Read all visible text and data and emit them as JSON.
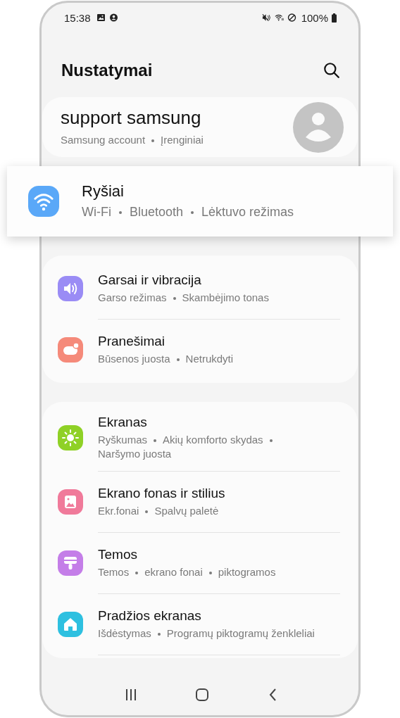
{
  "status_bar": {
    "time": "15:38",
    "battery": "100%"
  },
  "header": {
    "title": "Nustatymai"
  },
  "account": {
    "name": "support samsung",
    "parts": [
      "Samsung account",
      "Įrenginiai"
    ]
  },
  "groups": [
    {
      "continues": false,
      "items": [
        {
          "kind": "wifi",
          "color": "#5aa8f8",
          "highlighted": true,
          "title": "Ryšiai",
          "parts": [
            "Wi-Fi",
            "Bluetooth",
            "Lėktuvo režimas"
          ]
        }
      ]
    },
    {
      "continues": false,
      "items": [
        {
          "kind": "sound",
          "color": "#9a8cf5",
          "highlighted": false,
          "title": "Garsai ir vibracija",
          "parts": [
            "Garso režimas",
            "Skambėjimo tonas"
          ]
        },
        {
          "kind": "notification",
          "color": "#f58a7a",
          "highlighted": false,
          "title": "Pranešimai",
          "parts": [
            "Būsenos juosta",
            "Netrukdyti"
          ]
        }
      ]
    },
    {
      "continues": true,
      "items": [
        {
          "kind": "display",
          "color": "#8fd126",
          "highlighted": false,
          "title": "Ekranas",
          "parts": [
            "Ryškumas",
            "Akių komforto skydas",
            "Naršymo juosta"
          ]
        },
        {
          "kind": "wallpaper",
          "color": "#f07a9a",
          "highlighted": false,
          "title": "Ekrano fonas ir stilius",
          "parts": [
            "Ekr.fonai",
            "Spalvų paletė"
          ]
        },
        {
          "kind": "themes",
          "color": "#c47ee8",
          "highlighted": false,
          "title": "Temos",
          "parts": [
            "Temos",
            "ekrano fonai",
            "piktogramos"
          ]
        },
        {
          "kind": "home",
          "color": "#2ec0e0",
          "highlighted": false,
          "title": "Pradžios ekranas",
          "parts": [
            "Išdėstymas",
            "Programų piktogramų ženkleliai"
          ]
        }
      ]
    }
  ]
}
